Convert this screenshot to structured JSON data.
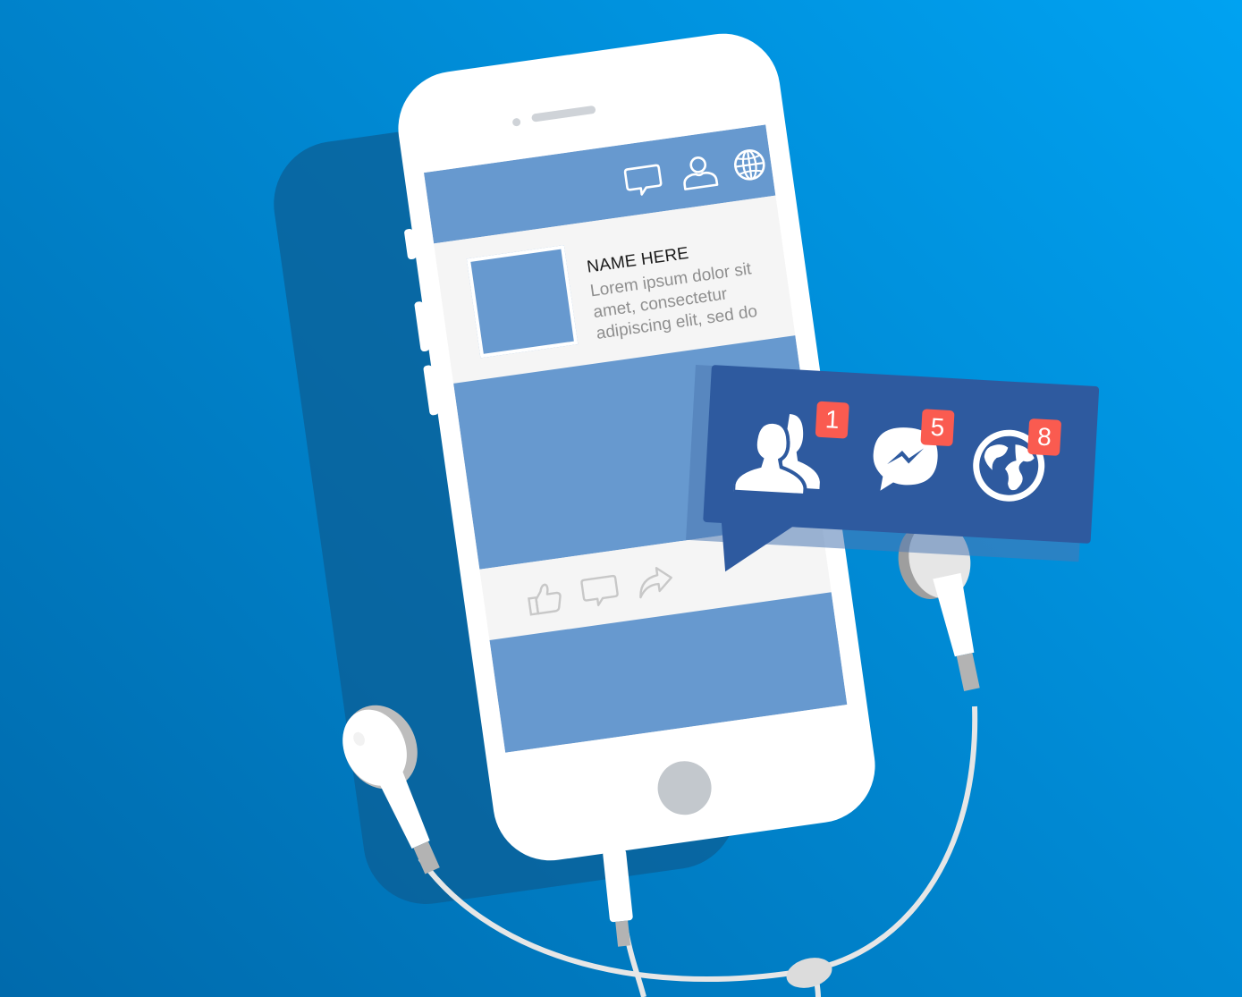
{
  "post": {
    "name": "NAME HERE",
    "text": "Lorem ipsum dolor sit amet, consectetur adipiscing elit, sed do"
  },
  "topbar_icons": [
    "chat-bubble-icon",
    "user-icon",
    "globe-icon"
  ],
  "action_icons": [
    "like-icon",
    "comment-icon",
    "share-icon"
  ],
  "notifications": [
    {
      "icon": "friend-requests-icon",
      "count": "1"
    },
    {
      "icon": "messenger-icon",
      "count": "5"
    },
    {
      "icon": "globe-icon",
      "count": "8"
    }
  ],
  "colors": {
    "background": "#0093dd",
    "screen_blue": "#6799cf",
    "notification_blue": "#2e5a9f",
    "badge_red": "#fa5b50"
  }
}
